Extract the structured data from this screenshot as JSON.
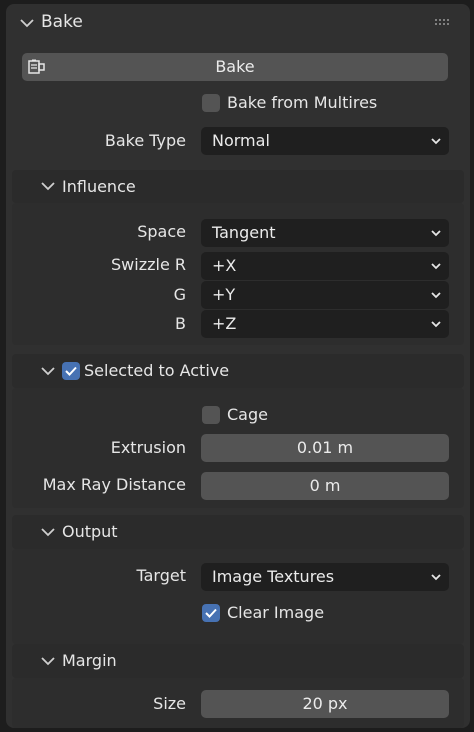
{
  "panel": {
    "title": "Bake"
  },
  "bake_button": {
    "label": "Bake",
    "icon": "bake-icon"
  },
  "bake_from_multires": {
    "label": "Bake from Multires",
    "checked": false
  },
  "bake_type": {
    "label": "Bake Type",
    "value": "Normal"
  },
  "influence": {
    "title": "Influence",
    "space": {
      "label": "Space",
      "value": "Tangent"
    },
    "swizzle_r": {
      "label": "Swizzle R",
      "value": "+X"
    },
    "swizzle_g": {
      "label": "G",
      "value": "+Y"
    },
    "swizzle_b": {
      "label": "B",
      "value": "+Z"
    }
  },
  "selected_to_active": {
    "title": "Selected to Active",
    "checked": true,
    "cage": {
      "label": "Cage",
      "checked": false
    },
    "extrusion": {
      "label": "Extrusion",
      "value": "0.01 m"
    },
    "max_ray_distance": {
      "label": "Max Ray Distance",
      "value": "0 m"
    }
  },
  "output": {
    "title": "Output",
    "target": {
      "label": "Target",
      "value": "Image Textures"
    },
    "clear_image": {
      "label": "Clear Image",
      "checked": true
    }
  },
  "margin": {
    "title": "Margin",
    "size": {
      "label": "Size",
      "value": "20 px"
    }
  }
}
